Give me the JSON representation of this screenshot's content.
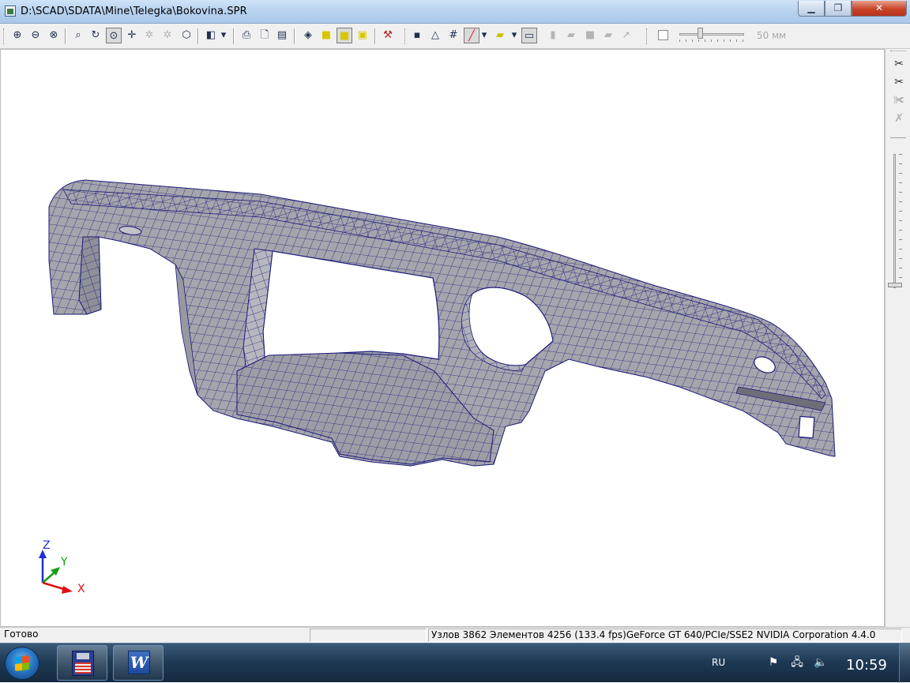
{
  "window": {
    "title": "D:\\SCAD\\SDATA\\Mine\\Telegka\\Bokovina.SPR",
    "min_glyph": "▁",
    "max_glyph": "❐",
    "close_glyph": "✕"
  },
  "toolbar": {
    "size_value": "50 мм"
  },
  "axes": {
    "z": "Z",
    "y": "Y",
    "x": "X",
    "z_color": "#1f2fd0",
    "y_color": "#10a010",
    "x_color": "#e01010"
  },
  "model": {
    "fill_color": "#a5a5ad",
    "mesh_color": "#1a1a7a"
  },
  "statusbar": {
    "ready": "Готово",
    "info": "Узлов 3862  Элементов 4256  (133.4 fps)GeForce GT 640/PCIe/SSE2 NVIDIA Corporation 4.4.0"
  },
  "taskbar": {
    "word_letter": "W",
    "language": "RU",
    "clock": "10:59"
  },
  "icons": {
    "zoom_in": "⊕",
    "zoom_out": "⊖",
    "zoom_all": "⊗",
    "zoom_window": "🔍",
    "rotate": "↻",
    "pan": "✥",
    "move": "✛",
    "print": "⎙",
    "cube": "◈",
    "hammer": "⚒",
    "scissors": "✂",
    "palette": "▰"
  }
}
